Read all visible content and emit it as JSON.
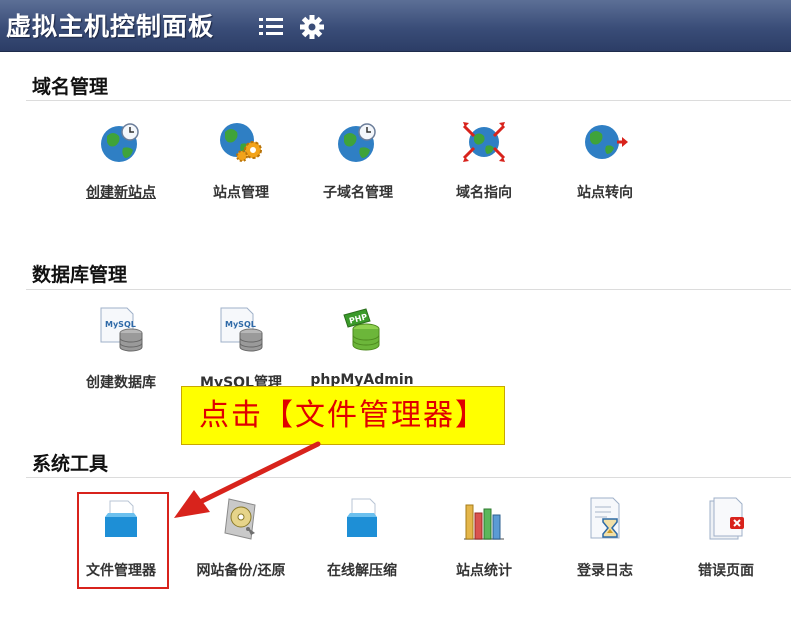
{
  "header": {
    "title": "虚拟主机控制面板"
  },
  "sections": {
    "domain": {
      "title": "域名管理",
      "items": [
        "创建新站点",
        "站点管理",
        "子域名管理",
        "域名指向",
        "站点转向"
      ]
    },
    "database": {
      "title": "数据库管理",
      "items": [
        "创建数据库",
        "MySQL管理",
        "phpMyAdmin"
      ]
    },
    "tools": {
      "title": "系统工具",
      "items": [
        "文件管理器",
        "网站备份/还原",
        "在线解压缩",
        "站点统计",
        "登录日志",
        "错误页面"
      ]
    }
  },
  "annotation": {
    "text": "点击【文件管理器】"
  },
  "colors": {
    "header": "#3a4d78",
    "callout_bg": "#ffff00",
    "callout_text": "#e00000",
    "arrow": "#d8231c"
  }
}
